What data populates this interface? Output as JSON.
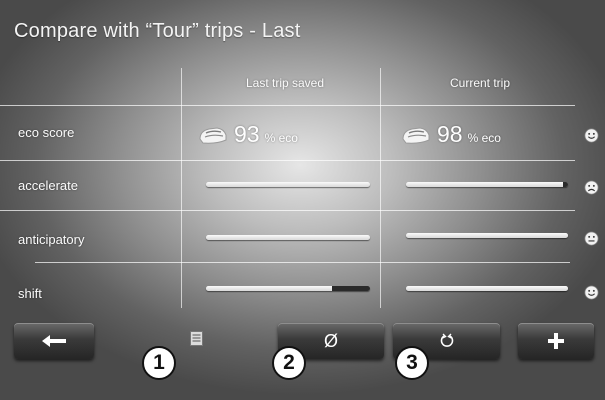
{
  "title": "Compare with “Tour” trips - Last",
  "columns": {
    "saved": "Last trip saved",
    "current": "Current trip"
  },
  "rows": [
    {
      "label": "eco score",
      "saved": {
        "value": "93",
        "unit": "% eco"
      },
      "current": {
        "value": "98",
        "unit": "% eco"
      },
      "rating": "happy-face-icon"
    },
    {
      "label": "accelerate",
      "saved_bar": 1.0,
      "current_bar": 0.97,
      "rating": "sad-face-icon"
    },
    {
      "label": "anticipatory",
      "saved_bar": 1.0,
      "current_bar": 1.0,
      "rating": "neutral-face-icon"
    },
    {
      "label": "shift",
      "saved_bar": 0.77,
      "current_bar": 1.0,
      "rating": "happy-face-icon"
    }
  ],
  "buttons": {
    "back": "left-arrow-icon",
    "average": "Ø",
    "reset": "reset-icon",
    "add": "plus-icon"
  },
  "callouts": [
    "1",
    "2",
    "3"
  ],
  "colors": {
    "text": "#f2f2f2",
    "bar": "#e8e8e8",
    "bar_empty": "#2a2a2a",
    "button": "#333333",
    "callout_bg": "#ffffff",
    "callout_border": "#111111"
  }
}
